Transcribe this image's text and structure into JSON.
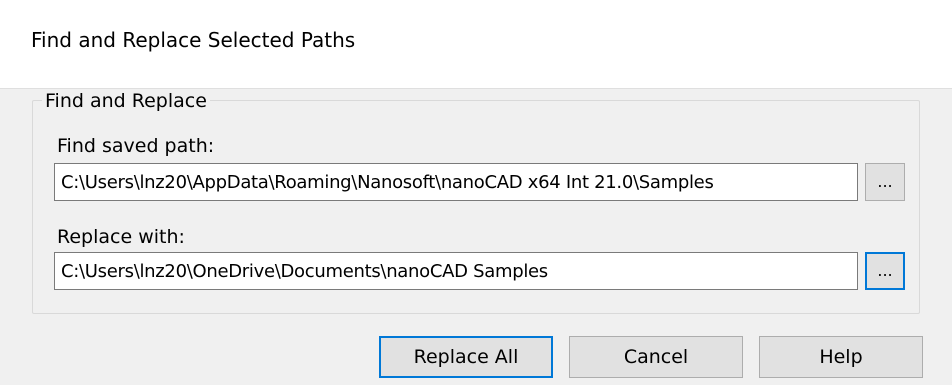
{
  "window": {
    "title": "Find and Replace Selected Paths"
  },
  "group": {
    "legend": "Find and Replace"
  },
  "find": {
    "label": "Find saved path:",
    "value": "C:\\Users\\lnz20\\AppData\\Roaming\\Nanosoft\\nanoCAD x64 Int 21.0\\Samples",
    "browse_label": "..."
  },
  "replace": {
    "label": "Replace with:",
    "value": "C:\\Users\\lnz20\\OneDrive\\Documents\\nanoCAD Samples",
    "browse_label": "..."
  },
  "buttons": {
    "replace_all": "Replace All",
    "cancel": "Cancel",
    "help": "Help"
  },
  "colors": {
    "focus_border": "#0078d7",
    "body_background": "#f0f0f0",
    "button_face": "#e1e1e1"
  }
}
